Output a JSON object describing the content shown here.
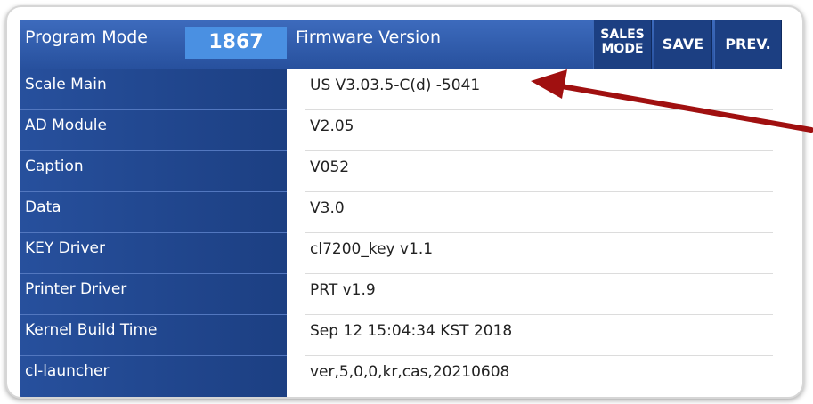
{
  "header": {
    "title": "Program Mode",
    "code": "1867",
    "page_title": "Firmware Version",
    "buttons": {
      "sales_line1": "SALES",
      "sales_line2": "MODE",
      "save": "SAVE",
      "prev": "PREV."
    }
  },
  "rows": [
    {
      "label": "Scale Main",
      "value": "US V3.03.5-C(d) -5041"
    },
    {
      "label": "AD Module",
      "value": "V2.05"
    },
    {
      "label": "Caption",
      "value": "V052"
    },
    {
      "label": "Data",
      "value": "V3.0"
    },
    {
      "label": "KEY Driver",
      "value": "cl7200_key v1.1"
    },
    {
      "label": "Printer Driver",
      "value": "PRT v1.9"
    },
    {
      "label": "Kernel Build Time",
      "value": "Sep 12 15:04:34 KST 2018"
    },
    {
      "label": "cl-launcher",
      "value": "ver,5,0,0,kr,cas,20210608"
    }
  ],
  "colors": {
    "header_bg": "#27509d",
    "code_box": "#4a90e2",
    "button_bg": "#1c3f82",
    "annotation_arrow": "#a01010"
  },
  "icons": {
    "annotation": "red-arrow-icon"
  }
}
